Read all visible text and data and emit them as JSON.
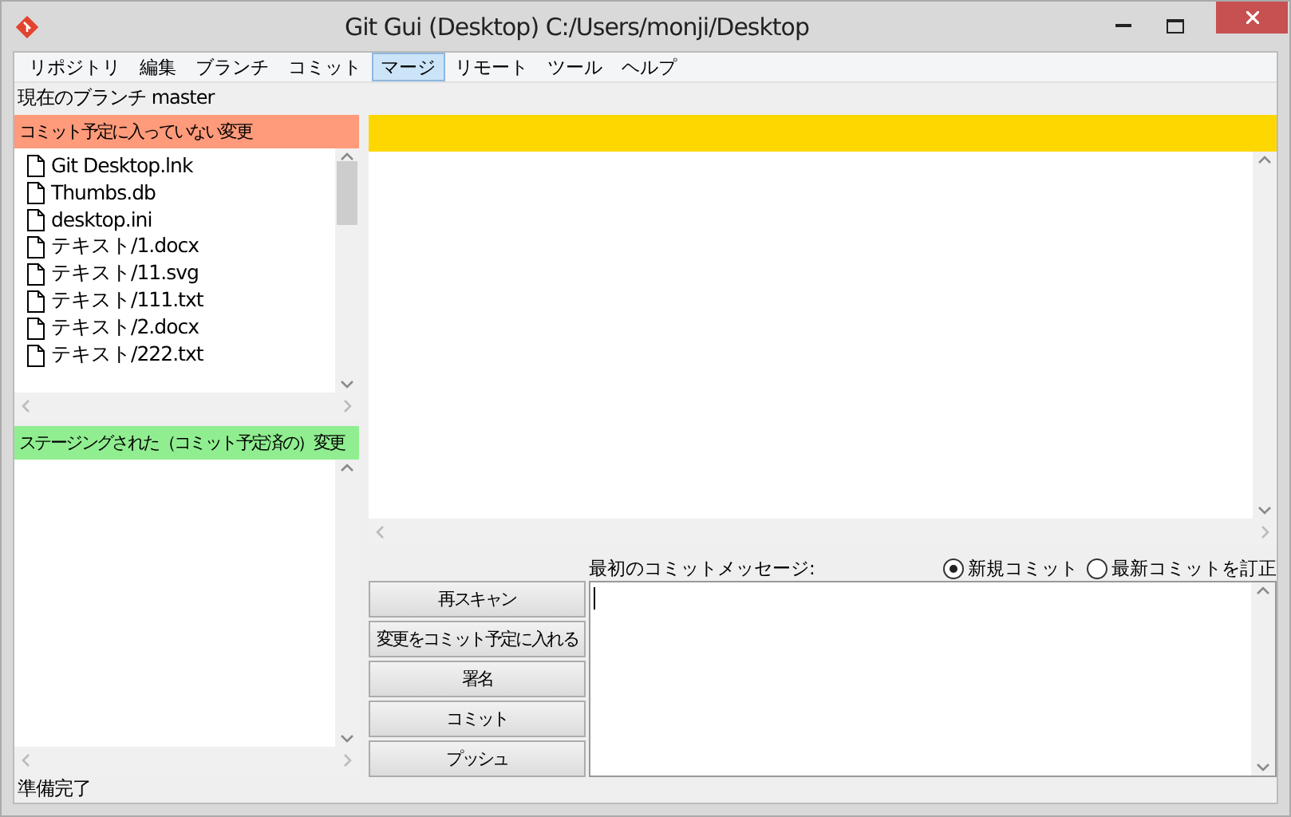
{
  "window": {
    "title": "Git Gui (Desktop) C:/Users/monji/Desktop"
  },
  "menu": [
    {
      "label": "リポジトリ",
      "selected": false
    },
    {
      "label": "編集",
      "selected": false
    },
    {
      "label": "ブランチ",
      "selected": false
    },
    {
      "label": "コミット",
      "selected": false
    },
    {
      "label": "マージ",
      "selected": true
    },
    {
      "label": "リモート",
      "selected": false
    },
    {
      "label": "ツール",
      "selected": false
    },
    {
      "label": "ヘルプ",
      "selected": false
    }
  ],
  "branch": "現在のブランチ master",
  "unstaged": {
    "title": "コミット予定に入っていない変更",
    "files": [
      "Git Desktop.lnk",
      "Thumbs.db",
      "desktop.ini",
      "テキスト/1.docx",
      "テキスト/11.svg",
      "テキスト/111.txt",
      "テキスト/2.docx",
      "テキスト/222.txt"
    ]
  },
  "staged": {
    "title": "ステージングされた（コミット予定済の）変更"
  },
  "commit": {
    "label": "最初のコミットメッセージ:",
    "options": [
      {
        "label": "新規コミット",
        "selected": true
      },
      {
        "label": "最新コミットを訂正",
        "selected": false
      }
    ],
    "buttons": [
      "再スキャン",
      "変更をコミット予定に入れる",
      "署名",
      "コミット",
      "プッシュ"
    ]
  },
  "status_bar": "準備完了"
}
